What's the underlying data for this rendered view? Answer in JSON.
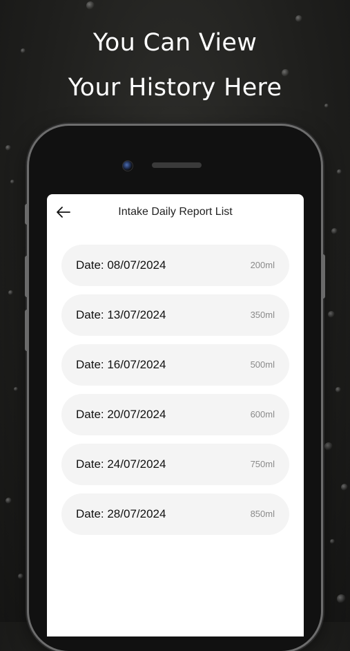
{
  "headline": {
    "line1": "You Can View",
    "line2": "Your History Here"
  },
  "screen": {
    "title": "Intake Daily Report List",
    "back_icon": "arrow-left-icon"
  },
  "reports": [
    {
      "date": "Date: 08/07/2024",
      "amount": "200ml"
    },
    {
      "date": "Date: 13/07/2024",
      "amount": "350ml"
    },
    {
      "date": "Date: 16/07/2024",
      "amount": "500ml"
    },
    {
      "date": "Date: 20/07/2024",
      "amount": "600ml"
    },
    {
      "date": "Date: 24/07/2024",
      "amount": "750ml"
    },
    {
      "date": "Date: 28/07/2024",
      "amount": "850ml"
    }
  ]
}
